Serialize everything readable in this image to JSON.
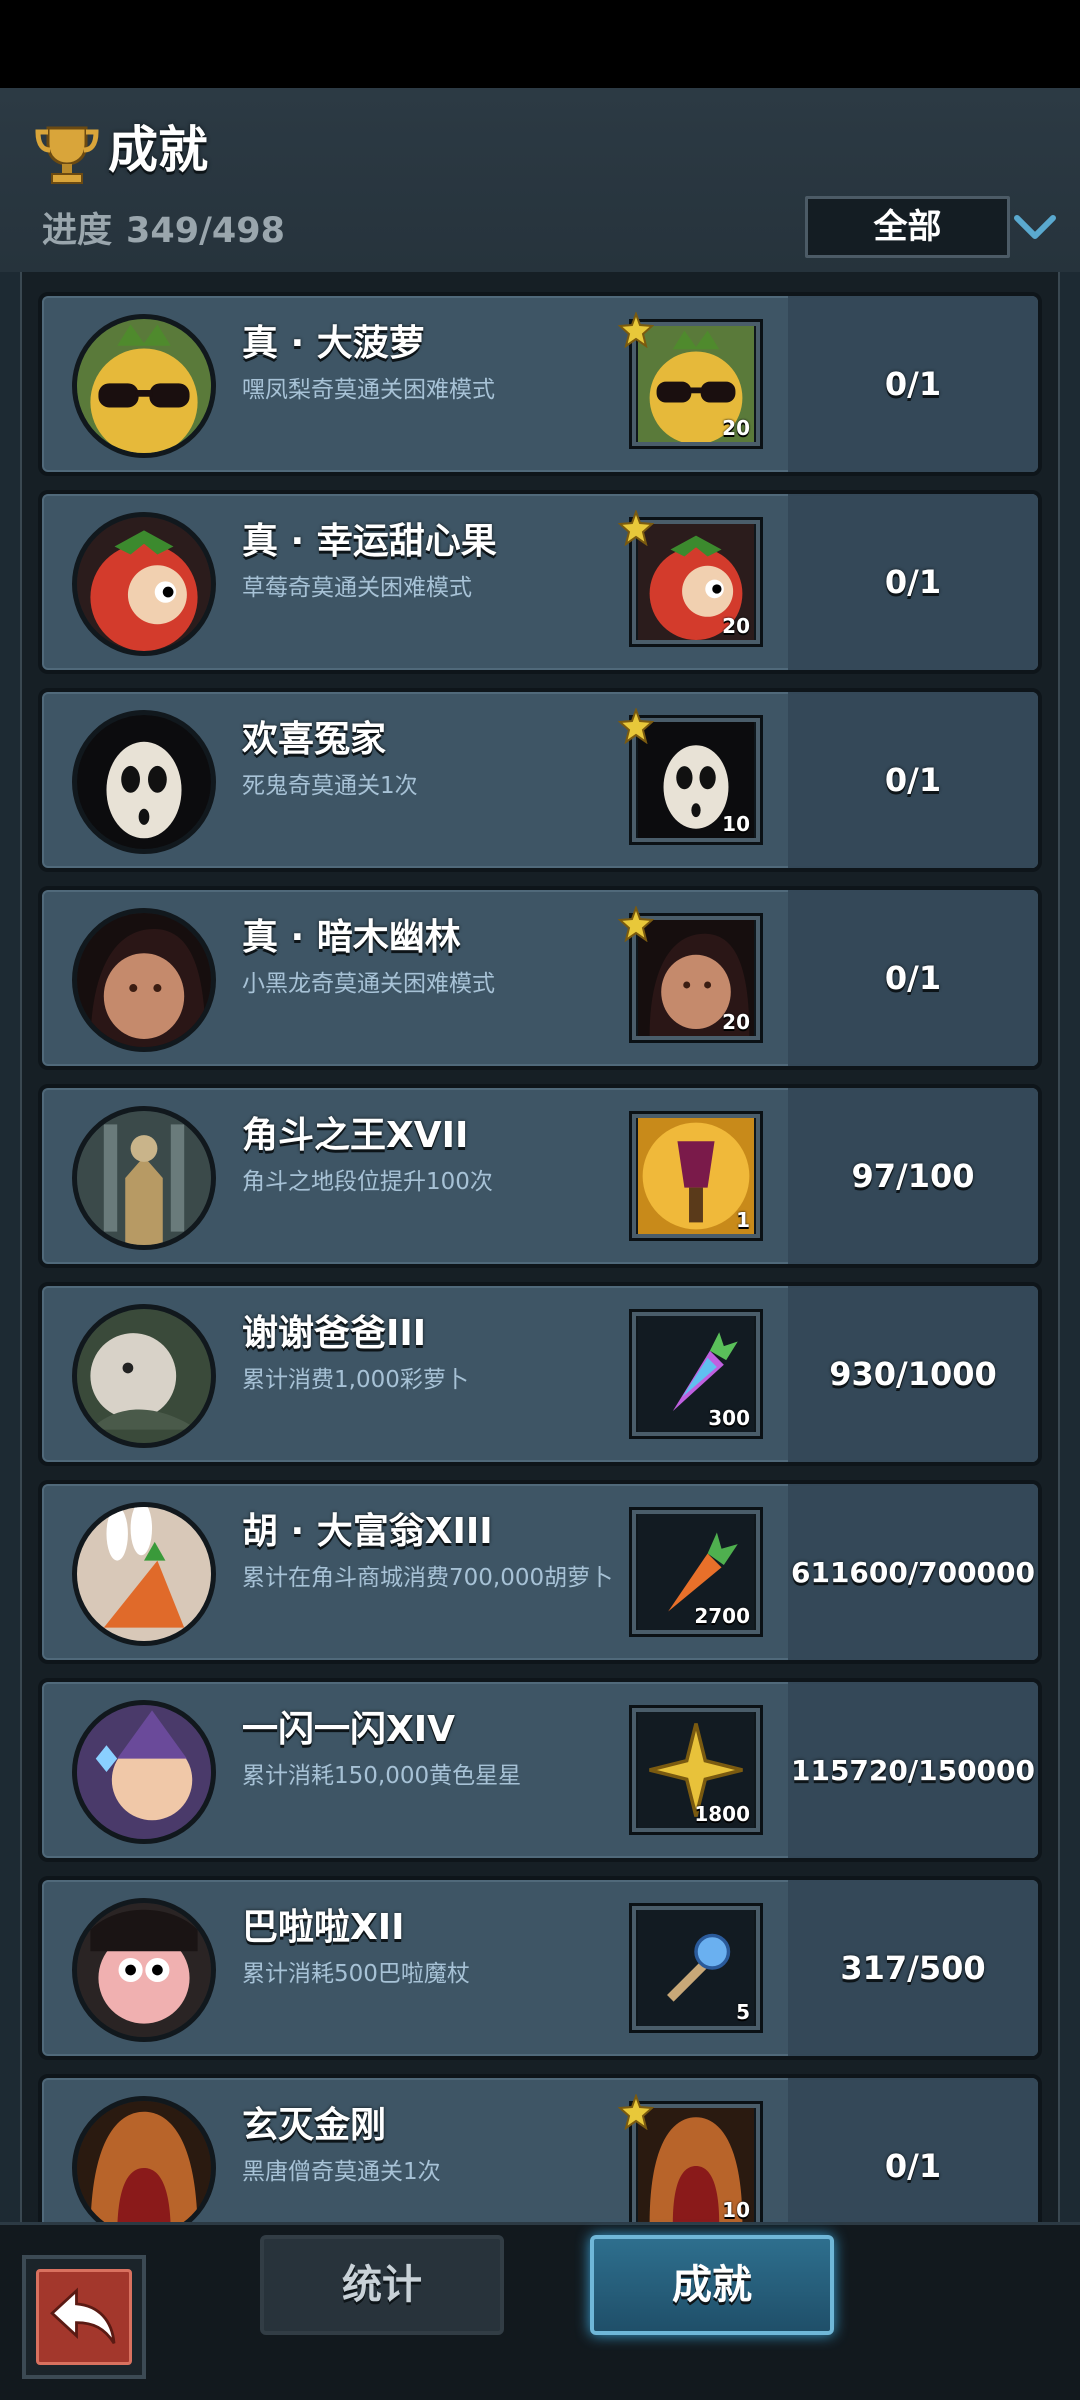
{
  "header": {
    "title": "成就",
    "progress_label": "进度",
    "progress_value": "349/498",
    "filter_selected": "全部"
  },
  "colors": {
    "row_bg": "#3e5565",
    "row_progress_bg": "#344858",
    "desc_text": "#a7c2d6",
    "accent_tab": "#2e6f8e",
    "back_button": "#a3372c"
  },
  "achievements": [
    {
      "name": "真 · 大菠萝",
      "desc": "嘿凤梨奇莫通关困难模式",
      "reward_qty": "20",
      "starred": true,
      "progress": "0/1",
      "avatar": "pineapple-sunglasses-icon",
      "reward_icon": "pineapple-sunglasses-icon"
    },
    {
      "name": "真 · 幸运甜心果",
      "desc": "草莓奇莫通关困难模式",
      "reward_qty": "20",
      "starred": true,
      "progress": "0/1",
      "avatar": "strawberry-character-icon",
      "reward_icon": "strawberry-character-icon"
    },
    {
      "name": "欢喜冤家",
      "desc": "死鬼奇莫通关1次",
      "reward_qty": "10",
      "starred": true,
      "progress": "0/1",
      "avatar": "ghost-mask-icon",
      "reward_icon": "ghost-mask-icon"
    },
    {
      "name": "真 · 暗木幽林",
      "desc": "小黑龙奇莫通关困难模式",
      "reward_qty": "20",
      "starred": true,
      "progress": "0/1",
      "avatar": "dark-hood-character-icon",
      "reward_icon": "dark-hood-character-icon"
    },
    {
      "name": "角斗之王XVII",
      "desc": "角斗之地段位提升100次",
      "reward_qty": "1",
      "starred": false,
      "progress": "97/100",
      "avatar": "knight-armor-icon",
      "reward_icon": "purple-torch-icon"
    },
    {
      "name": "谢谢爸爸III",
      "desc": "累计消费1,000彩萝卜",
      "reward_qty": "300",
      "starred": false,
      "progress": "930/1000",
      "avatar": "old-man-character-icon",
      "reward_icon": "rainbow-carrot-icon"
    },
    {
      "name": "胡 · 大富翁XIII",
      "desc": "累计在角斗商城消费700,000胡萝卜",
      "reward_qty": "2700",
      "starred": false,
      "progress": "611600/700000",
      "avatar": "rabbit-carrots-icon",
      "reward_icon": "carrot-icon"
    },
    {
      "name": "一闪一闪XIV",
      "desc": "累计消耗150,000黄色星星",
      "reward_qty": "1800",
      "starred": false,
      "progress": "115720/150000",
      "avatar": "wizard-character-icon",
      "reward_icon": "yellow-star-icon"
    },
    {
      "name": "巴啦啦XII",
      "desc": "累计消耗500巴啦魔杖",
      "reward_qty": "5",
      "starred": false,
      "progress": "317/500",
      "avatar": "pink-face-character-icon",
      "reward_icon": "magic-wand-icon"
    },
    {
      "name": "玄灭金刚",
      "desc": "黑唐僧奇莫通关1次",
      "reward_qty": "10",
      "starred": true,
      "progress": "0/1",
      "avatar": "monk-hood-icon",
      "reward_icon": "monk-hood-icon"
    }
  ],
  "bottom_tabs": [
    {
      "label": "统计",
      "active": false
    },
    {
      "label": "成就",
      "active": true
    }
  ],
  "back_button_icon": "back-arrow-icon"
}
